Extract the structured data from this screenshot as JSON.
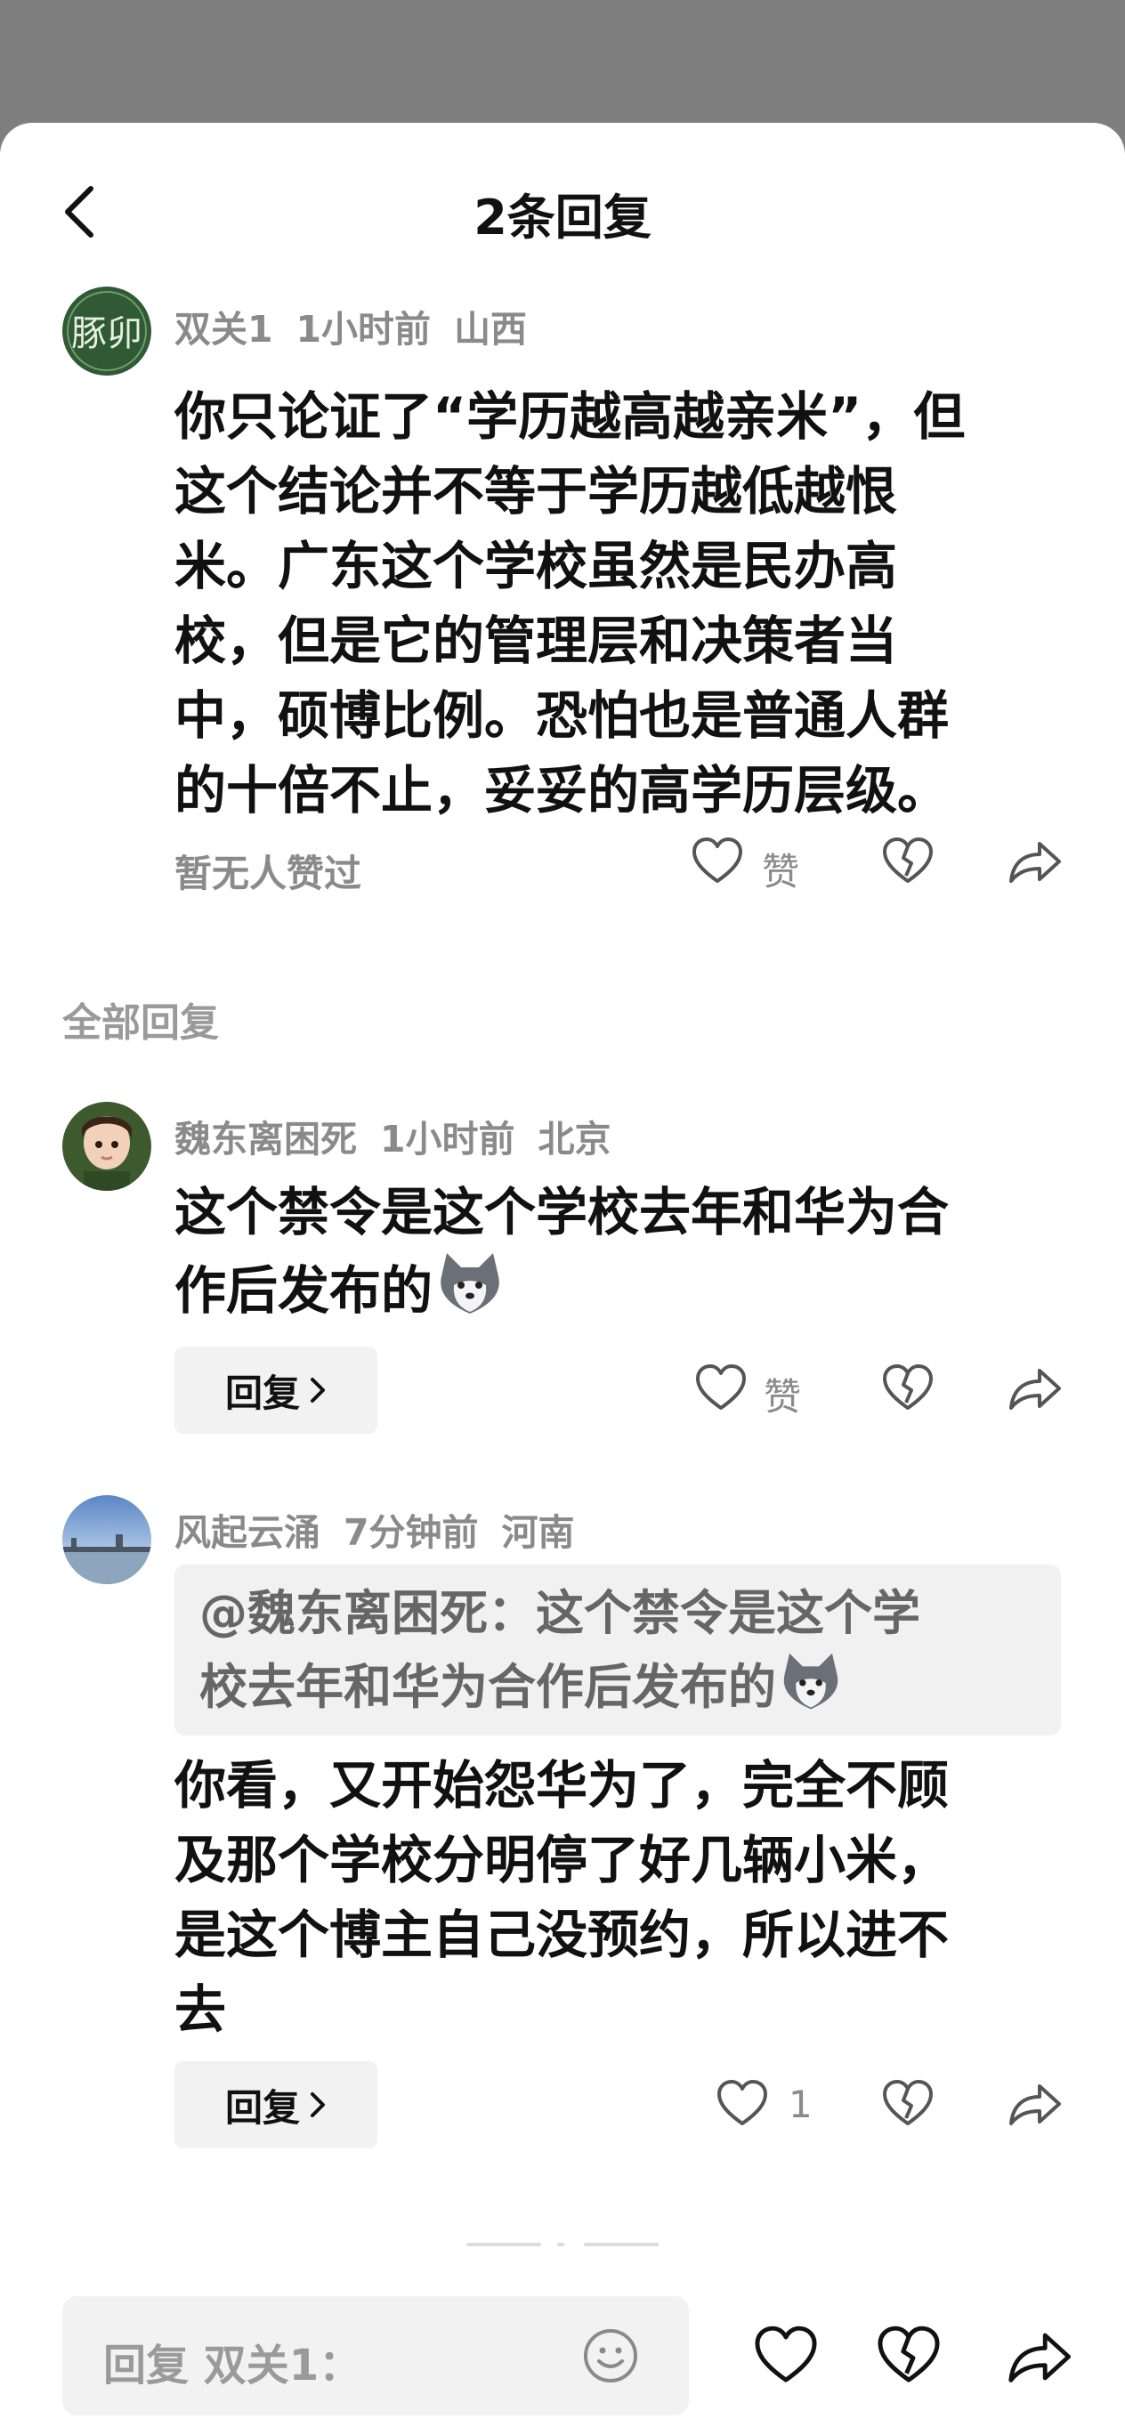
{
  "header": {
    "title": "2条回复"
  },
  "main_comment": {
    "user": "双关1",
    "time": "1小时前",
    "location": "山西",
    "avatar_text": "豚卯",
    "lines": [
      "你只论证了“学历越高越亲米”，但",
      "这个结论并不等于学历越低越恨",
      "米。广东这个学校虽然是民办高",
      "校，但是它的管理层和决策者当",
      "中，硕博比例。恐怕也是普通人群",
      "的十倍不止，妥妥的高学历层级。"
    ],
    "likes_text": "暂无人赞过",
    "like_label": "赞"
  },
  "section_label": "全部回复",
  "replies": [
    {
      "user": "魏东离困死",
      "time": "1小时前",
      "location": "北京",
      "lines": [
        "这个禁令是这个学校去年和华为合",
        "作后发布的"
      ],
      "reply_label": "回复",
      "like_label": "赞"
    },
    {
      "user": "风起云涌",
      "time": "7分钟前",
      "location": "河南",
      "quote_lines": [
        "@魏东离困死：这个禁令是这个学",
        "校去年和华为合作后发布的"
      ],
      "lines": [
        "你看，又开始怨华为了，完全不顾",
        "及那个学校分明停了好几辆小米，",
        "是这个博主自己没预约，所以进不",
        "去"
      ],
      "reply_label": "回复",
      "like_count": "1"
    }
  ],
  "composer": {
    "placeholder": "回复 双关1："
  },
  "icons": [
    "back-arrow-icon",
    "heart-icon",
    "broken-heart-icon",
    "share-icon",
    "chevron-right-icon",
    "emoji-smile-icon",
    "husky-emoji-icon"
  ],
  "colors": {
    "text": "#111111",
    "muted": "#8a8a8a",
    "pill_bg": "#f2f2f2",
    "backdrop": "#7f7f7f"
  }
}
